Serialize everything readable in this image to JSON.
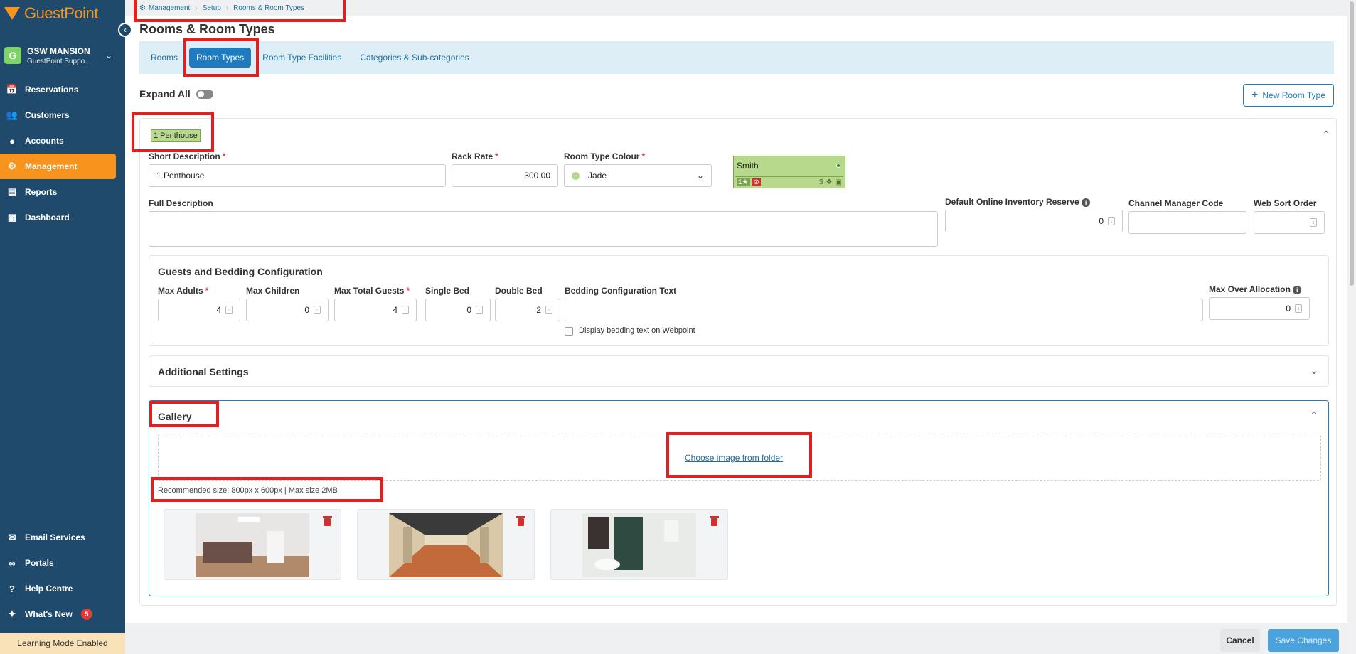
{
  "app": {
    "logo_text": "GuestPoint"
  },
  "property": {
    "avatar_letter": "G",
    "name": "GSW MANSION",
    "subtitle": "GuestPoint Suppo..."
  },
  "sidebar": {
    "items": [
      {
        "label": "Reservations",
        "icon": "calendar-icon"
      },
      {
        "label": "Customers",
        "icon": "users-icon"
      },
      {
        "label": "Accounts",
        "icon": "dollar-icon"
      },
      {
        "label": "Management",
        "icon": "user-gear-icon",
        "active": true
      },
      {
        "label": "Reports",
        "icon": "report-icon"
      },
      {
        "label": "Dashboard",
        "icon": "bar-chart-icon"
      }
    ],
    "bottom_items": [
      {
        "label": "Email Services",
        "icon": "mail-icon"
      },
      {
        "label": "Portals",
        "icon": "link-icon"
      },
      {
        "label": "Help Centre",
        "icon": "help-icon"
      },
      {
        "label": "What's New",
        "icon": "sparkle-icon",
        "badge": "5"
      }
    ],
    "learning_mode": "Learning Mode Enabled"
  },
  "breadcrumb": {
    "items": [
      "Management",
      "Setup",
      "Rooms & Room Types"
    ]
  },
  "page": {
    "title": "Rooms & Room Types"
  },
  "tabs": [
    {
      "label": "Rooms"
    },
    {
      "label": "Room Types",
      "active": true
    },
    {
      "label": "Room Type Facilities"
    },
    {
      "label": "Categories & Sub-categories"
    }
  ],
  "toolbar": {
    "expand_all": "Expand All",
    "new_room_type": "New Room Type"
  },
  "room_type": {
    "badge": "1 Penthouse",
    "short_description": {
      "label": "Short Description",
      "value": "1 Penthouse"
    },
    "rack_rate": {
      "label": "Rack Rate",
      "value": "300.00"
    },
    "colour": {
      "label": "Room Type Colour",
      "value": "Jade",
      "swatch": "#b7d98b"
    },
    "preview": {
      "name": "Smith",
      "tag": "1★"
    },
    "full_description": {
      "label": "Full Description",
      "value": ""
    },
    "default_online_inventory": {
      "label": "Default Online Inventory Reserve",
      "value": "0"
    },
    "channel_manager_code": {
      "label": "Channel Manager Code",
      "value": ""
    },
    "web_sort_order": {
      "label": "Web Sort Order",
      "value": ""
    }
  },
  "guests": {
    "title": "Guests and Bedding Configuration",
    "max_adults": {
      "label": "Max Adults",
      "value": "4"
    },
    "max_children": {
      "label": "Max Children",
      "value": "0"
    },
    "max_total_guests": {
      "label": "Max Total Guests",
      "value": "4"
    },
    "single_bed": {
      "label": "Single Bed",
      "value": "0"
    },
    "double_bed": {
      "label": "Double Bed",
      "value": "2"
    },
    "bedding_text": {
      "label": "Bedding Configuration Text",
      "value": ""
    },
    "display_bedding": {
      "label": "Display bedding text on Webpoint"
    },
    "max_over_allocation": {
      "label": "Max Over Allocation",
      "value": "0"
    }
  },
  "additional_settings": {
    "title": "Additional Settings"
  },
  "gallery": {
    "title": "Gallery",
    "choose_link": "Choose image from folder",
    "recommended": "Recommended size: 800px x 600px | Max size 2MB"
  },
  "footer": {
    "cancel": "Cancel",
    "save": "Save Changes"
  },
  "colors": {
    "sidebar": "#1f4a6b",
    "accent": "#f7941d",
    "primary": "#1f7bbf",
    "highlight": "#e41e1e"
  }
}
